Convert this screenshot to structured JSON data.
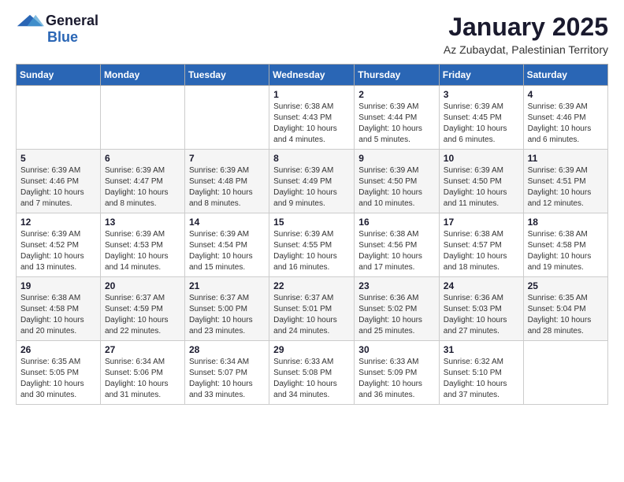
{
  "header": {
    "logo_general": "General",
    "logo_blue": "Blue",
    "title": "January 2025",
    "subtitle": "Az Zubaydat, Palestinian Territory"
  },
  "calendar": {
    "days": [
      "Sunday",
      "Monday",
      "Tuesday",
      "Wednesday",
      "Thursday",
      "Friday",
      "Saturday"
    ],
    "weeks": [
      [
        {
          "date": "",
          "info": ""
        },
        {
          "date": "",
          "info": ""
        },
        {
          "date": "",
          "info": ""
        },
        {
          "date": "1",
          "info": "Sunrise: 6:38 AM\nSunset: 4:43 PM\nDaylight: 10 hours\nand 4 minutes."
        },
        {
          "date": "2",
          "info": "Sunrise: 6:39 AM\nSunset: 4:44 PM\nDaylight: 10 hours\nand 5 minutes."
        },
        {
          "date": "3",
          "info": "Sunrise: 6:39 AM\nSunset: 4:45 PM\nDaylight: 10 hours\nand 6 minutes."
        },
        {
          "date": "4",
          "info": "Sunrise: 6:39 AM\nSunset: 4:46 PM\nDaylight: 10 hours\nand 6 minutes."
        }
      ],
      [
        {
          "date": "5",
          "info": "Sunrise: 6:39 AM\nSunset: 4:46 PM\nDaylight: 10 hours\nand 7 minutes."
        },
        {
          "date": "6",
          "info": "Sunrise: 6:39 AM\nSunset: 4:47 PM\nDaylight: 10 hours\nand 8 minutes."
        },
        {
          "date": "7",
          "info": "Sunrise: 6:39 AM\nSunset: 4:48 PM\nDaylight: 10 hours\nand 8 minutes."
        },
        {
          "date": "8",
          "info": "Sunrise: 6:39 AM\nSunset: 4:49 PM\nDaylight: 10 hours\nand 9 minutes."
        },
        {
          "date": "9",
          "info": "Sunrise: 6:39 AM\nSunset: 4:50 PM\nDaylight: 10 hours\nand 10 minutes."
        },
        {
          "date": "10",
          "info": "Sunrise: 6:39 AM\nSunset: 4:50 PM\nDaylight: 10 hours\nand 11 minutes."
        },
        {
          "date": "11",
          "info": "Sunrise: 6:39 AM\nSunset: 4:51 PM\nDaylight: 10 hours\nand 12 minutes."
        }
      ],
      [
        {
          "date": "12",
          "info": "Sunrise: 6:39 AM\nSunset: 4:52 PM\nDaylight: 10 hours\nand 13 minutes."
        },
        {
          "date": "13",
          "info": "Sunrise: 6:39 AM\nSunset: 4:53 PM\nDaylight: 10 hours\nand 14 minutes."
        },
        {
          "date": "14",
          "info": "Sunrise: 6:39 AM\nSunset: 4:54 PM\nDaylight: 10 hours\nand 15 minutes."
        },
        {
          "date": "15",
          "info": "Sunrise: 6:39 AM\nSunset: 4:55 PM\nDaylight: 10 hours\nand 16 minutes."
        },
        {
          "date": "16",
          "info": "Sunrise: 6:38 AM\nSunset: 4:56 PM\nDaylight: 10 hours\nand 17 minutes."
        },
        {
          "date": "17",
          "info": "Sunrise: 6:38 AM\nSunset: 4:57 PM\nDaylight: 10 hours\nand 18 minutes."
        },
        {
          "date": "18",
          "info": "Sunrise: 6:38 AM\nSunset: 4:58 PM\nDaylight: 10 hours\nand 19 minutes."
        }
      ],
      [
        {
          "date": "19",
          "info": "Sunrise: 6:38 AM\nSunset: 4:58 PM\nDaylight: 10 hours\nand 20 minutes."
        },
        {
          "date": "20",
          "info": "Sunrise: 6:37 AM\nSunset: 4:59 PM\nDaylight: 10 hours\nand 22 minutes."
        },
        {
          "date": "21",
          "info": "Sunrise: 6:37 AM\nSunset: 5:00 PM\nDaylight: 10 hours\nand 23 minutes."
        },
        {
          "date": "22",
          "info": "Sunrise: 6:37 AM\nSunset: 5:01 PM\nDaylight: 10 hours\nand 24 minutes."
        },
        {
          "date": "23",
          "info": "Sunrise: 6:36 AM\nSunset: 5:02 PM\nDaylight: 10 hours\nand 25 minutes."
        },
        {
          "date": "24",
          "info": "Sunrise: 6:36 AM\nSunset: 5:03 PM\nDaylight: 10 hours\nand 27 minutes."
        },
        {
          "date": "25",
          "info": "Sunrise: 6:35 AM\nSunset: 5:04 PM\nDaylight: 10 hours\nand 28 minutes."
        }
      ],
      [
        {
          "date": "26",
          "info": "Sunrise: 6:35 AM\nSunset: 5:05 PM\nDaylight: 10 hours\nand 30 minutes."
        },
        {
          "date": "27",
          "info": "Sunrise: 6:34 AM\nSunset: 5:06 PM\nDaylight: 10 hours\nand 31 minutes."
        },
        {
          "date": "28",
          "info": "Sunrise: 6:34 AM\nSunset: 5:07 PM\nDaylight: 10 hours\nand 33 minutes."
        },
        {
          "date": "29",
          "info": "Sunrise: 6:33 AM\nSunset: 5:08 PM\nDaylight: 10 hours\nand 34 minutes."
        },
        {
          "date": "30",
          "info": "Sunrise: 6:33 AM\nSunset: 5:09 PM\nDaylight: 10 hours\nand 36 minutes."
        },
        {
          "date": "31",
          "info": "Sunrise: 6:32 AM\nSunset: 5:10 PM\nDaylight: 10 hours\nand 37 minutes."
        },
        {
          "date": "",
          "info": ""
        }
      ]
    ]
  }
}
